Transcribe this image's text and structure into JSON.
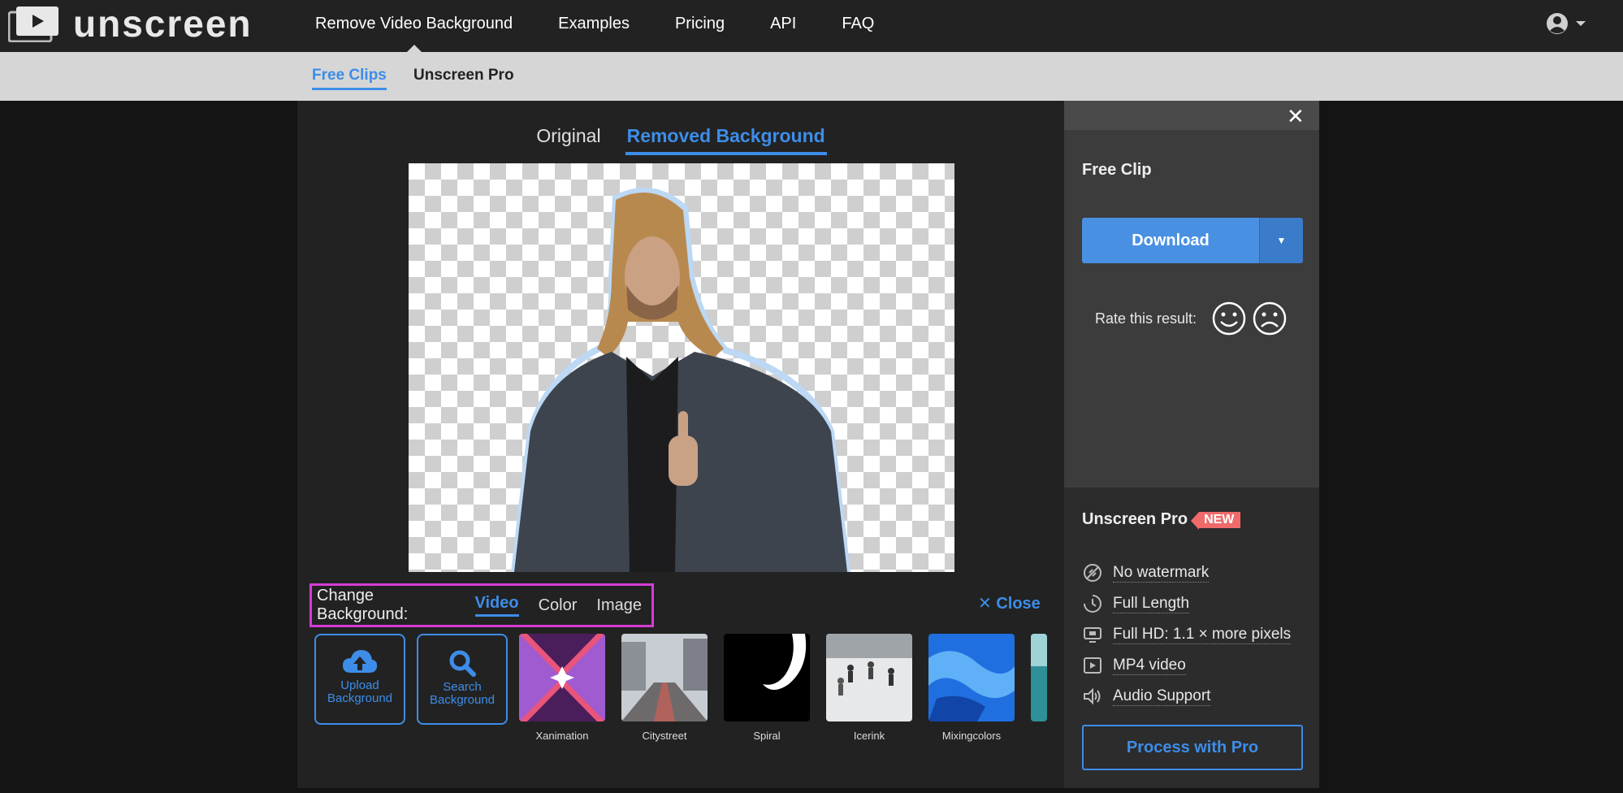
{
  "brand": {
    "name": "unscreen"
  },
  "nav": {
    "items": [
      {
        "label": "Remove Video Background"
      },
      {
        "label": "Examples"
      },
      {
        "label": "Pricing"
      },
      {
        "label": "API"
      },
      {
        "label": "FAQ"
      }
    ]
  },
  "subnav": {
    "free_clips": "Free Clips",
    "pro": "Unscreen Pro"
  },
  "editor": {
    "tab_original": "Original",
    "tab_removed": "Removed Background",
    "change_bg_label": "Change Background:",
    "bg_tabs": [
      "Video",
      "Color",
      "Image"
    ],
    "close_label": "Close",
    "upload_label": "Upload Background",
    "search_label": "Search Background",
    "thumbnails": [
      "Xanimation",
      "Citystreet",
      "Spiral",
      "Icerink",
      "Mixingcolors"
    ]
  },
  "side": {
    "free_clip_title": "Free Clip",
    "download_label": "Download",
    "rate_label": "Rate this result:",
    "pro_title": "Unscreen Pro",
    "new_badge": "NEW",
    "features": [
      "No watermark",
      "Full Length",
      "Full HD: 1.1 × more pixels",
      "MP4 video",
      "Audio Support"
    ],
    "pro_button": "Process with Pro"
  },
  "colors": {
    "accent": "#3d8de8",
    "highlight_border": "#d63bd6",
    "new_badge": "#f06a6a"
  }
}
